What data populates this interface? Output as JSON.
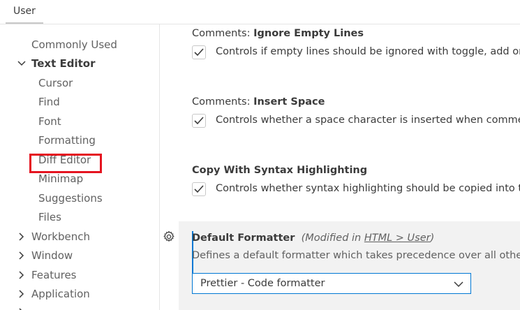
{
  "scope_tab": "User",
  "toc": [
    {
      "label": "Commonly Used",
      "level": 0,
      "expanded": null,
      "bold": false
    },
    {
      "label": "Text Editor",
      "level": 0,
      "expanded": true,
      "bold": true
    },
    {
      "label": "Cursor",
      "level": 1,
      "bold": false
    },
    {
      "label": "Find",
      "level": 1,
      "bold": false
    },
    {
      "label": "Font",
      "level": 1,
      "bold": false
    },
    {
      "label": "Formatting",
      "level": 1,
      "bold": false
    },
    {
      "label": "Diff Editor",
      "level": 1,
      "bold": false
    },
    {
      "label": "Minimap",
      "level": 1,
      "bold": false
    },
    {
      "label": "Suggestions",
      "level": 1,
      "bold": false
    },
    {
      "label": "Files",
      "level": 1,
      "bold": false
    },
    {
      "label": "Workbench",
      "level": 0,
      "expanded": false,
      "bold": false
    },
    {
      "label": "Window",
      "level": 0,
      "expanded": false,
      "bold": false
    },
    {
      "label": "Features",
      "level": 0,
      "expanded": false,
      "bold": false
    },
    {
      "label": "Application",
      "level": 0,
      "expanded": false,
      "bold": false
    }
  ],
  "settings": [
    {
      "category": "Comments: ",
      "name": "Ignore Empty Lines",
      "description": "Controls if empty lines should be ignored with toggle, add or",
      "checked": true
    },
    {
      "category": "Comments: ",
      "name": "Insert Space",
      "description": "Controls whether a space character is inserted when commer",
      "checked": true
    },
    {
      "category": "",
      "name": "Copy With Syntax Highlighting",
      "description": "Controls whether syntax highlighting should be copied into th",
      "checked": true
    }
  ],
  "default_formatter": {
    "name": "Default Formatter",
    "modified_prefix": "(Modified in ",
    "modified_link": "HTML > User",
    "modified_suffix": ")",
    "description": "Defines a default formatter which takes precedence over all other",
    "value": "Prettier - Code formatter"
  },
  "colors": {
    "accent": "#0078d4",
    "highlight": "#e51420"
  }
}
